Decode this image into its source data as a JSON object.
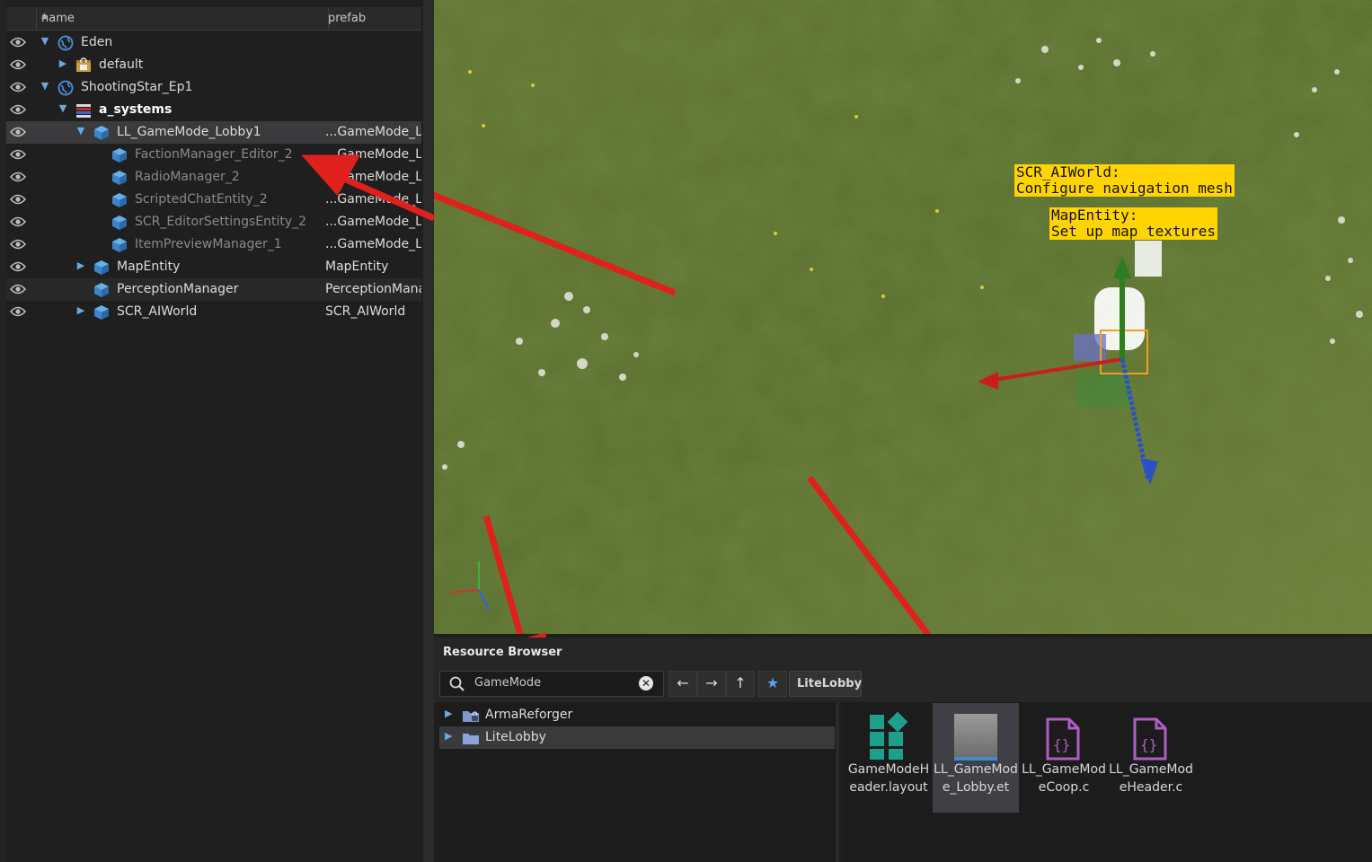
{
  "hierarchy": {
    "columns": {
      "name": "name",
      "prefab": "prefab"
    },
    "rows": [
      {
        "label": "Eden",
        "prefab": "",
        "icon": "world-icon",
        "expand": "expanded"
      },
      {
        "label": "default",
        "prefab": "",
        "icon": "layer-lock-icon",
        "expand": "collapsed"
      },
      {
        "label": "ShootingStar_Ep1",
        "prefab": "",
        "icon": "world-icon",
        "expand": "expanded"
      },
      {
        "label": "a_systems",
        "prefab": "",
        "icon": "layer-icon",
        "expand": "expanded"
      },
      {
        "label": "LL_GameMode_Lobby1",
        "prefab": "...GameMode_Lc",
        "icon": "entity-cube-icon",
        "expand": "expanded"
      },
      {
        "label": "FactionManager_Editor_2",
        "prefab": "...GameMode_Lc",
        "icon": "entity-cube-icon",
        "expand": "none"
      },
      {
        "label": "RadioManager_2",
        "prefab": "...GameMode_Lc",
        "icon": "entity-cube-icon",
        "expand": "none"
      },
      {
        "label": "ScriptedChatEntity_2",
        "prefab": "...GameMode_Lc",
        "icon": "entity-cube-icon",
        "expand": "none"
      },
      {
        "label": "SCR_EditorSettingsEntity_2",
        "prefab": "...GameMode_Lc",
        "icon": "entity-cube-icon",
        "expand": "none"
      },
      {
        "label": "ItemPreviewManager_1",
        "prefab": "...GameMode_Lc",
        "icon": "entity-cube-icon",
        "expand": "none"
      },
      {
        "label": "MapEntity",
        "prefab": "MapEntity",
        "icon": "entity-cube-icon",
        "expand": "collapsed"
      },
      {
        "label": "PerceptionManager",
        "prefab": "PerceptionMana",
        "icon": "entity-cube-icon",
        "expand": "none"
      },
      {
        "label": "SCR_AIWorld",
        "prefab": "SCR_AIWorld",
        "icon": "entity-cube-icon",
        "expand": "collapsed"
      }
    ]
  },
  "viewport": {
    "labels": [
      {
        "text": "SCR_AIWorld:\nConfigure navigation mesh"
      },
      {
        "text": "MapEntity:\nSet up map textures"
      }
    ],
    "gizmo_colors": {
      "x": "#d8262a",
      "y": "#3d8a2a",
      "z": "#2a5fd0"
    },
    "annotation_arrow_color": "#e0201c"
  },
  "resource_browser": {
    "title": "Resource Browser",
    "search_value": "GameMode",
    "favorite_chip": "LiteLobby",
    "tree": [
      {
        "label": "ArmaReforger",
        "icon": "locked-folder-icon"
      },
      {
        "label": "LiteLobby",
        "icon": "folder-icon"
      }
    ],
    "files": [
      {
        "name": "GameModeHeader.layout",
        "icon": "layout-icon"
      },
      {
        "name": "LL_GameMode_Lobby.et",
        "icon": "prefab-thumbnail-icon"
      },
      {
        "name": "LL_GameModeCoop.c",
        "icon": "script-file-icon"
      },
      {
        "name": "LL_GameModeHeader.c",
        "icon": "script-file-icon"
      }
    ]
  }
}
